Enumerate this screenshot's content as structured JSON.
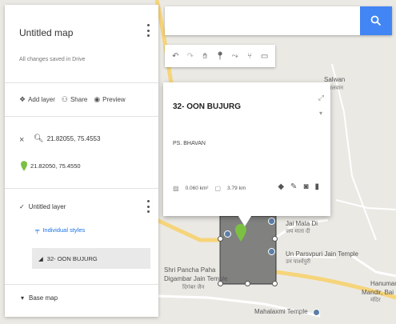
{
  "map_panel": {
    "title": "Untitled map",
    "subtitle": "All changes saved in Drive",
    "actions": {
      "add_layer": "Add layer",
      "share": "Share",
      "preview": "Preview"
    },
    "search_result": {
      "query": "21.82055, 75.4553",
      "pin_label": "21.82050, 75.4550"
    },
    "layer": {
      "name": "Untitled layer",
      "styles_label": "Individual styles",
      "feature": "32- OON BUJURG"
    },
    "base_map": "Base map"
  },
  "search": {
    "value": "",
    "placeholder": ""
  },
  "info_card": {
    "title": "32- OON BUJURG",
    "description": "PS. BHAVAN",
    "area": "0.060 km²",
    "perimeter": "3.79 km"
  },
  "map_labels": {
    "salwan": "Salwan",
    "salwan_hi": "सलवान",
    "jai_mata": "Jai Mata Di",
    "jai_mata_hi": "जय माता दी",
    "un_parsvpuri": "Un Parsvpuri Jain Temple",
    "un_parsvpuri_hi": "उन पार्श्वपुरी",
    "shri_pancha": "Shri Pancha Paha",
    "digambar": "Digambar Jain Temple",
    "digambar_hi": "दिगंबर जैन",
    "hanuman": "Hanuman",
    "mandir": "Mandir, Bai",
    "mandir_hi": "मंदिर",
    "mahalaxmi": "Mahalaxmi Temple"
  },
  "colors": {
    "accent_blue": "#4285f4",
    "marker_green": "#7bc043",
    "polygon_fill": "#6f6f6f"
  },
  "icons": {
    "search": "search-icon",
    "marker": "green-pin-icon"
  }
}
